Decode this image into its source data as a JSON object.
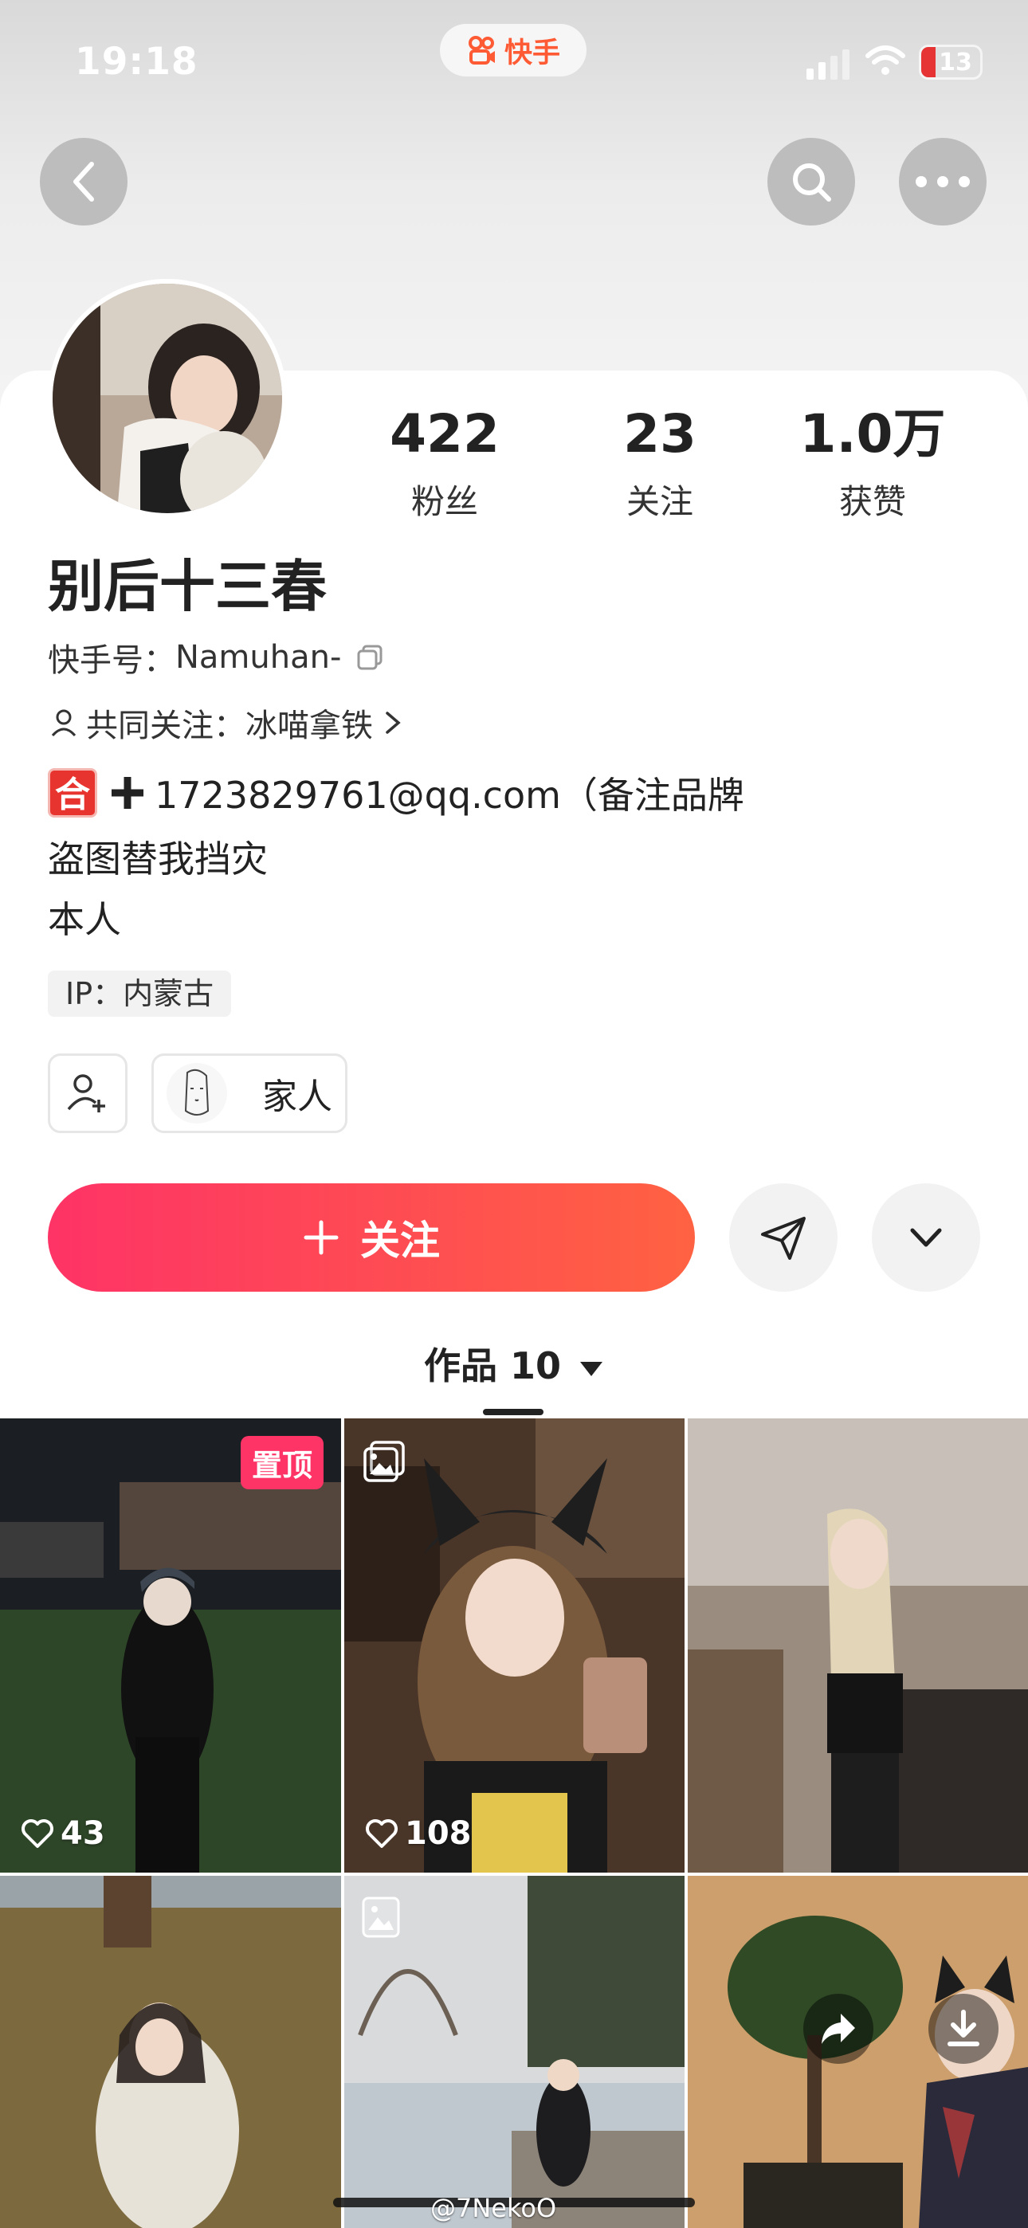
{
  "status_bar": {
    "time": "19:18",
    "battery": "13"
  },
  "brand": {
    "name": "快手",
    "color": "#fe5a34"
  },
  "nav": {
    "back_icon": "chevron-left-icon",
    "search_icon": "search-icon",
    "more_icon": "more-icon"
  },
  "profile": {
    "name": "别后十三春",
    "kuaishou_id_label": "快手号：",
    "kuaishou_id": "Namuhan-",
    "mutual_label": "共同关注：",
    "mutual_name": "冰喵拿铁",
    "bio_badge": "合",
    "bio_line1": "1723829761@qq.com（备注品牌",
    "bio_line2": "盗图替我挡灾",
    "bio_line3": "本人",
    "ip": "IP：内蒙古",
    "relation_tag": "家人"
  },
  "stats": [
    {
      "value": "422",
      "label": "粉丝"
    },
    {
      "value": "23",
      "label": "关注"
    },
    {
      "value": "1.0万",
      "label": "获赞"
    }
  ],
  "actions": {
    "follow_label": "关注",
    "follow_gradient": [
      "#fe3366",
      "#ff6242"
    ]
  },
  "tabs": {
    "works_label": "作品 10"
  },
  "posts": [
    {
      "likes": "43",
      "pinned_label": "置顶",
      "scene": "night-field"
    },
    {
      "likes": "108",
      "scene": "cafe"
    },
    {
      "likes": "",
      "scene": "mall"
    },
    {
      "likes": "",
      "scene": "park-autumn"
    },
    {
      "likes": "",
      "scene": "winter-lake"
    },
    {
      "likes": "",
      "scene": "indoor-plant"
    }
  ],
  "watermark": "@7NekoO"
}
